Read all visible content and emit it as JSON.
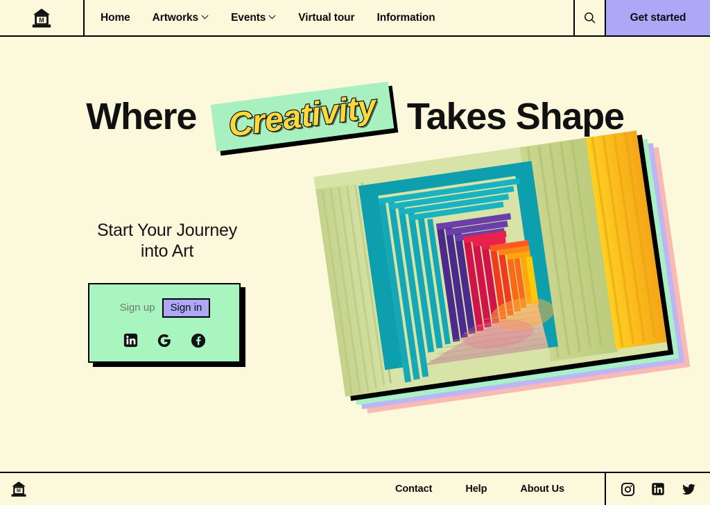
{
  "site": {
    "name": "Museum",
    "background_color": "#FBF8DC",
    "accent_purple": "#ACA8F5",
    "accent_mint": "#A8F5C0",
    "accent_yellow": "#FFD83D"
  },
  "header": {
    "logo_icon": "museum-building-icon",
    "logo_letter": "M",
    "nav": [
      {
        "label": "Home",
        "has_dropdown": false
      },
      {
        "label": "Artworks",
        "has_dropdown": true
      },
      {
        "label": "Events",
        "has_dropdown": true
      },
      {
        "label": "Virtual tour",
        "has_dropdown": false
      },
      {
        "label": "Information",
        "has_dropdown": false
      }
    ],
    "search_icon": "search-icon",
    "cta_label": "Get started"
  },
  "hero": {
    "headline_part1": "Where",
    "headline_highlight": "Creativity",
    "headline_part2": "Takes Shape"
  },
  "left_panel": {
    "subheading_line1": "Start Your  Journey",
    "subheading_line2": "into Art",
    "auth": {
      "signup_label": "Sign up",
      "signin_label": "Sign in",
      "social": [
        {
          "name": "linkedin-icon",
          "label": "LinkedIn"
        },
        {
          "name": "google-icon",
          "label": "Google"
        },
        {
          "name": "facebook-icon",
          "label": "Facebook"
        }
      ]
    }
  },
  "artwork": {
    "alt": "Colorful layered corridor installation with vertical slats",
    "stack_colors": [
      "#FBB9B3",
      "#BDB6F2",
      "#A8F0C8",
      "#000000"
    ]
  },
  "footer": {
    "logo_icon": "museum-building-icon",
    "links": [
      {
        "label": "Contact"
      },
      {
        "label": "Help"
      },
      {
        "label": "About Us"
      }
    ],
    "social": [
      {
        "name": "instagram-icon",
        "label": "Instagram"
      },
      {
        "name": "linkedin-icon",
        "label": "LinkedIn"
      },
      {
        "name": "twitter-icon",
        "label": "Twitter"
      }
    ]
  }
}
